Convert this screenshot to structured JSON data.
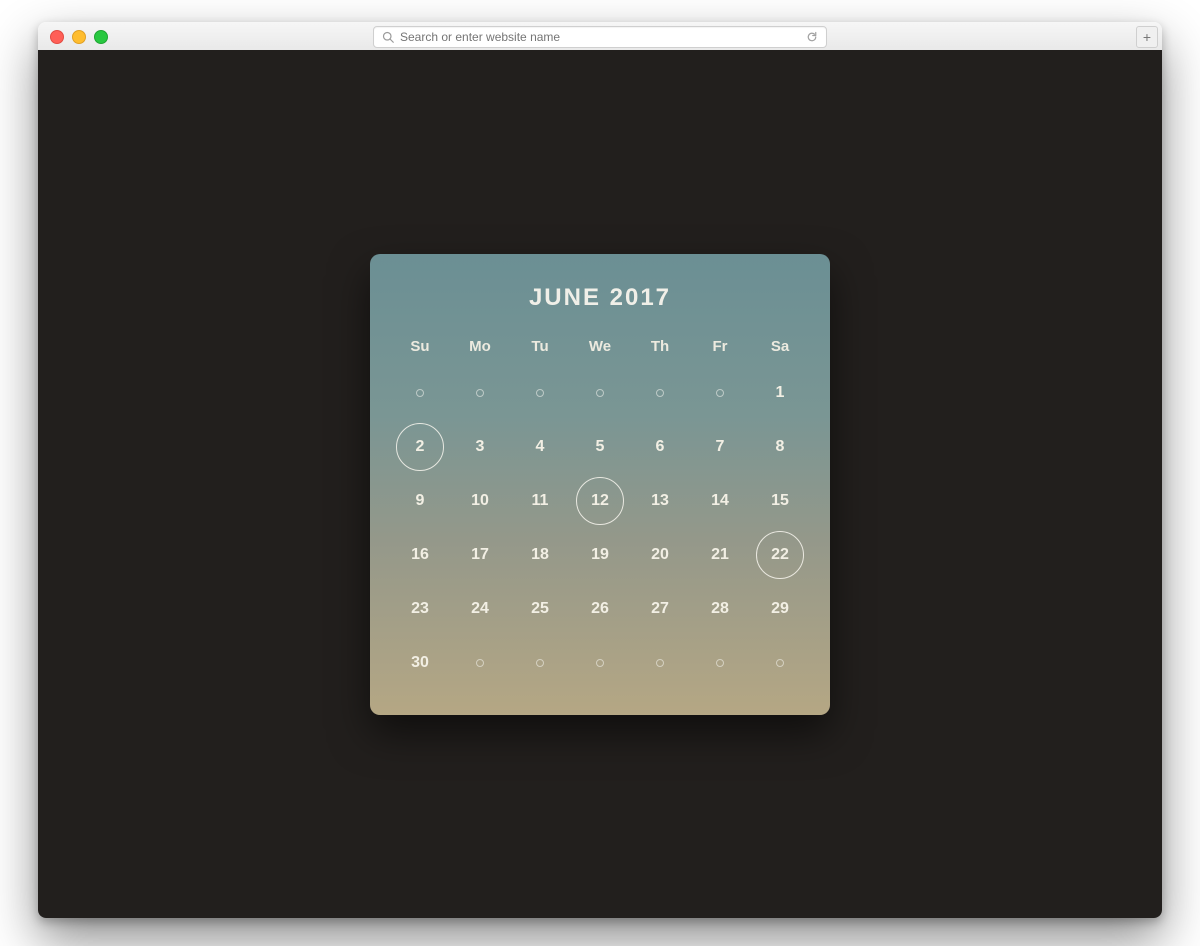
{
  "browser": {
    "address_placeholder": "Search or enter website name"
  },
  "calendar": {
    "title": "JUNE 2017",
    "weekdays": [
      "Su",
      "Mo",
      "Tu",
      "We",
      "Th",
      "Fr",
      "Sa"
    ],
    "selected_days": [
      2,
      12,
      22
    ],
    "weeks": [
      [
        null,
        null,
        null,
        null,
        null,
        null,
        1
      ],
      [
        2,
        3,
        4,
        5,
        6,
        7,
        8
      ],
      [
        9,
        10,
        11,
        12,
        13,
        14,
        15
      ],
      [
        16,
        17,
        18,
        19,
        20,
        21,
        22
      ],
      [
        23,
        24,
        25,
        26,
        27,
        28,
        29
      ],
      [
        30,
        null,
        null,
        null,
        null,
        null,
        null
      ]
    ]
  }
}
